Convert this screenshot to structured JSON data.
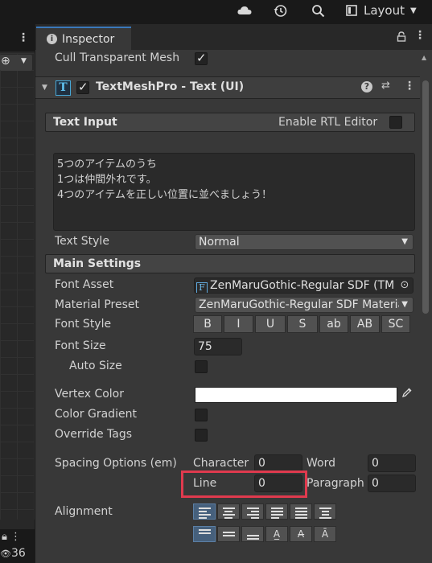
{
  "toolbar": {
    "cloud_icon": "cloud-icon",
    "history_icon": "history-icon",
    "search_icon": "search-icon",
    "layout_label": "Layout"
  },
  "scene_strip": {
    "visible_count": "36"
  },
  "inspector": {
    "tab_label": "Inspector",
    "cull_transparent_mesh_label": "Cull Transparent Mesh",
    "cull_transparent_mesh_checked": true,
    "component": {
      "title": "TextMeshPro - Text (UI)",
      "enabled": true
    },
    "text_input": {
      "section_label": "Text Input",
      "rtl_label": "Enable RTL Editor",
      "rtl_checked": false,
      "lines": [
        "5つのアイテムのうち",
        "1つは仲間外れです。",
        "4つのアイテムを正しい位置に並べましょう！"
      ]
    },
    "text_style": {
      "label": "Text Style",
      "value": "Normal"
    },
    "main_settings": {
      "section_label": "Main Settings",
      "font_asset": {
        "label": "Font Asset",
        "value": "ZenMaruGothic-Regular SDF (TM"
      },
      "material_preset": {
        "label": "Material Preset",
        "value": "ZenMaruGothic-Regular SDF Material"
      },
      "font_style": {
        "label": "Font Style",
        "buttons": [
          "B",
          "I",
          "U",
          "S",
          "ab",
          "AB",
          "SC"
        ]
      },
      "font_size": {
        "label": "Font Size",
        "value": "75"
      },
      "auto_size": {
        "label": "Auto Size",
        "checked": false
      },
      "vertex_color": {
        "label": "Vertex Color",
        "color": "#ffffff"
      },
      "color_gradient": {
        "label": "Color Gradient",
        "checked": false
      },
      "override_tags": {
        "label": "Override Tags",
        "checked": false
      },
      "spacing": {
        "label": "Spacing Options (em)",
        "character_label": "Character",
        "character_value": "0",
        "word_label": "Word",
        "word_value": "0",
        "line_label": "Line",
        "line_value": "0",
        "paragraph_label": "Paragraph",
        "paragraph_value": "0"
      },
      "alignment": {
        "label": "Alignment"
      }
    }
  },
  "colors": {
    "highlight": "#e03a4e",
    "accent": "#3a79bb"
  }
}
